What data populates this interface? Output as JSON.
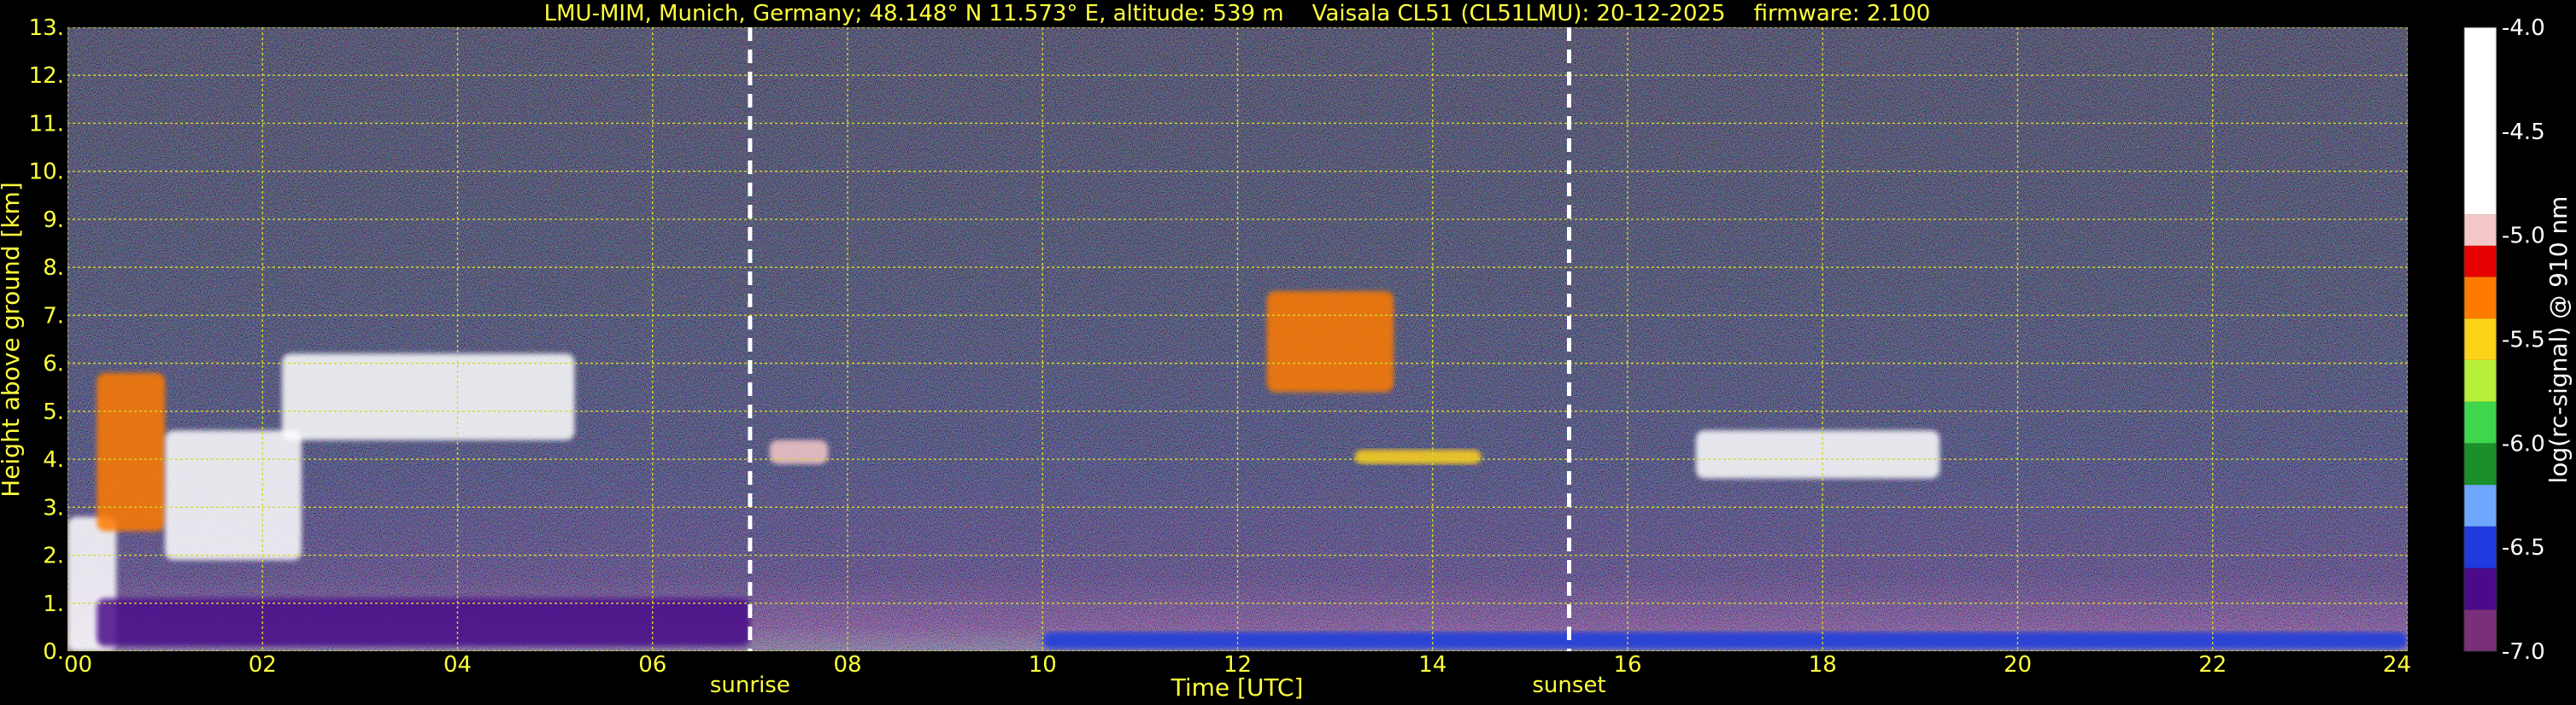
{
  "chart_data": {
    "type": "heatmap",
    "title": "LMU-MIM, Munich, Germany; 48.148° N 11.573° E, altitude: 539 m    Vaisala CL51 (CL51LMU): 20-12-2025    firmware: 2.100",
    "xlabel": "Time [UTC]",
    "ylabel": "Height above ground [km]",
    "xlim": [
      0,
      24
    ],
    "ylim": [
      0,
      13
    ],
    "x_ticks": [
      "00",
      "02",
      "04",
      "06",
      "08",
      "10",
      "12",
      "14",
      "16",
      "18",
      "20",
      "22",
      "24"
    ],
    "y_ticks": [
      "0.",
      "1.",
      "2.",
      "3.",
      "4.",
      "5.",
      "6.",
      "7.",
      "8.",
      "9.",
      "10.",
      "11.",
      "12.",
      "13."
    ],
    "grid": true,
    "events": [
      {
        "label": "sunrise",
        "time": 7.0
      },
      {
        "label": "sunset",
        "time": 15.4
      }
    ],
    "colorbar": {
      "label": "log(rc-signal) @ 910 nm",
      "range": [
        -7.0,
        -4.0
      ],
      "ticks": [
        "-4.0",
        "-4.5",
        "-5.0",
        "-5.5",
        "-6.0",
        "-6.5",
        "-7.0"
      ]
    },
    "features": [
      {
        "t0": 0.0,
        "t1": 0.5,
        "h0": 0.0,
        "h1": 2.8,
        "level": -4.2
      },
      {
        "t0": 0.3,
        "t1": 1.0,
        "h0": 2.5,
        "h1": 5.8,
        "level": -5.2
      },
      {
        "t0": 1.0,
        "t1": 2.4,
        "h0": 1.9,
        "h1": 4.6,
        "level": -4.5
      },
      {
        "t0": 2.2,
        "t1": 5.2,
        "h0": 4.4,
        "h1": 6.2,
        "level": -4.5
      },
      {
        "t0": 0.3,
        "t1": 7.0,
        "h0": 0.1,
        "h1": 1.1,
        "level": -6.6
      },
      {
        "t0": 7.2,
        "t1": 7.8,
        "h0": 3.9,
        "h1": 4.4,
        "level": -5.0
      },
      {
        "t0": 12.3,
        "t1": 13.6,
        "h0": 5.4,
        "h1": 7.5,
        "level": -5.3
      },
      {
        "t0": 13.2,
        "t1": 14.5,
        "h0": 3.9,
        "h1": 4.2,
        "level": -5.4
      },
      {
        "t0": 16.7,
        "t1": 19.2,
        "h0": 3.6,
        "h1": 4.6,
        "level": -4.5
      },
      {
        "t0": 10.0,
        "t1": 24.0,
        "h0": 0.05,
        "h1": 0.4,
        "level": -6.5
      }
    ]
  }
}
